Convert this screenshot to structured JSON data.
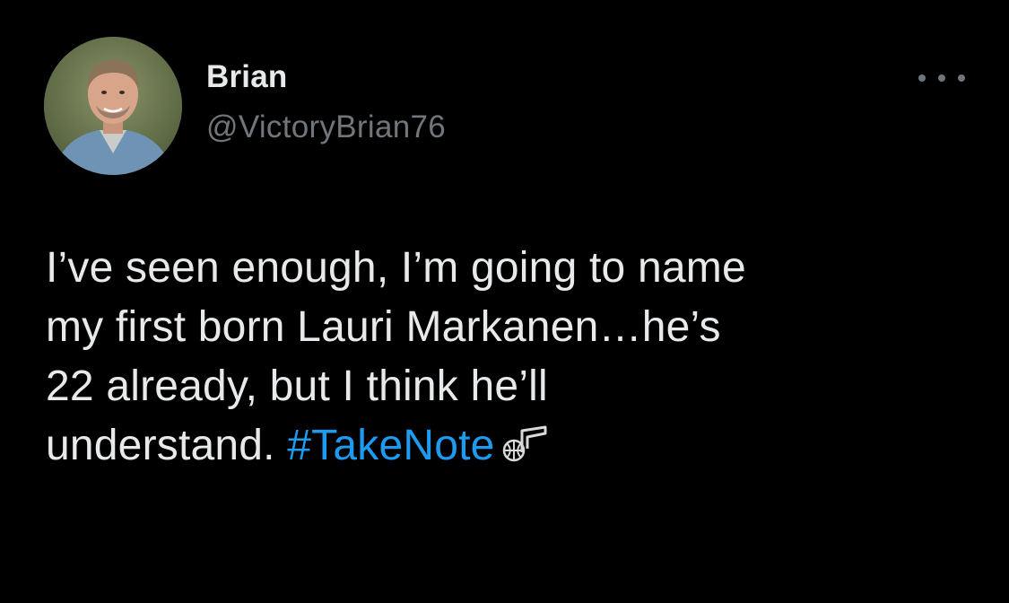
{
  "author": {
    "name": "Brian",
    "handle": "@VictoryBrian76"
  },
  "tweet": {
    "lines": [
      "I’ve seen enough, I’m going to name",
      "my first born Lauri Markanen…he’s",
      "22 already, but I think he’ll"
    ],
    "last_line_text": "understand. ",
    "hashtag": "#TakeNote",
    "hashflag_icon": "utah-jazz-note-icon"
  },
  "colors": {
    "background": "#000000",
    "text": "#e7e9ea",
    "secondary": "#71767b",
    "link": "#1d9bf0"
  },
  "icons": {
    "more": "more-horizontal-icon"
  }
}
